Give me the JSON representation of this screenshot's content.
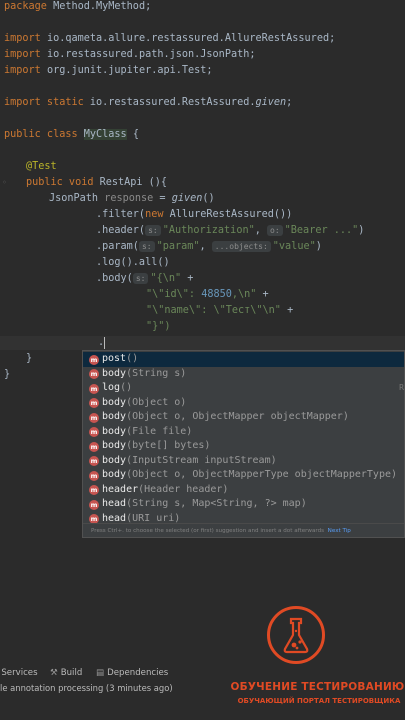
{
  "code": {
    "l1_kw": "package",
    "l1_rest": " Method.MyMethod;",
    "imp_kw": "import",
    "imp1": " io.qameta.allure.restassured.AllureRestAssured;",
    "imp2": " io.restassured.path.json.JsonPath;",
    "imp3": " org.junit.jupiter.api.Test;",
    "imp_static_kw": "import static",
    "imp4_pre": " io.restassured.RestAssured.",
    "imp4_it": "given",
    "imp4_end": ";",
    "class_kw": "public class",
    "class_name": "MyClass",
    "class_brace": " {",
    "annotation": "@Test",
    "method_kw": "public void",
    "method_rest": " RestApi (){",
    "decl_type": "JsonPath",
    "decl_var": " response",
    "decl_eq": " = ",
    "decl_given": "given",
    "decl_paren": "()",
    "filter_pre": ".filter(",
    "filter_new": "new",
    "filter_rest": " AllureRestAssured())",
    "header_pre": ".header(",
    "header_hint1": "s:",
    "header_s1": "\"Authorization\"",
    "header_comma": ", ",
    "header_hint2": "o:",
    "header_s2": "\"Bearer ...\"",
    "header_end": ")",
    "param_pre": ".param(",
    "param_hint1": "s:",
    "param_s1": "\"param\"",
    "param_comma": ", ",
    "param_hint2": "...objects:",
    "param_s2": "\"value\"",
    "param_end": ")",
    "log_line": ".log().all()",
    "body_pre": ".body(",
    "body_hint": "s:",
    "body_s1": "\"{\\n\"",
    "body_plus": " +",
    "body_l2_a": "\"\\\"id\\\": ",
    "body_l2_num": "48850",
    "body_l2_b": ",\\n\"",
    "body_l3": "\"\\\"name\\\": \\\"Тест\\\"\\n\"",
    "body_l4": "\"}\")",
    "dot": ".",
    "brace_close": "}",
    "brace_close2": "}"
  },
  "popup": {
    "items": [
      {
        "name": "post",
        "params": "()",
        "right": ""
      },
      {
        "name": "body",
        "params": "(String s)",
        "right": ""
      },
      {
        "name": "log",
        "params": "()",
        "right": "R"
      },
      {
        "name": "body",
        "params": "(Object o)",
        "right": ""
      },
      {
        "name": "body",
        "params": "(Object o, ObjectMapper objectMapper)",
        "right": ""
      },
      {
        "name": "body",
        "params": "(File file)",
        "right": ""
      },
      {
        "name": "body",
        "params": "(byte[] bytes)",
        "right": ""
      },
      {
        "name": "body",
        "params": "(InputStream inputStream)",
        "right": ""
      },
      {
        "name": "body",
        "params": "(Object o, ObjectMapperType objectMapperType)",
        "right": ""
      },
      {
        "name": "header",
        "params": "(Header header)",
        "right": ""
      },
      {
        "name": "head",
        "params": "(String s, Map<String, ?> map)",
        "right": ""
      },
      {
        "name": "head",
        "params": "(URI uri)",
        "right": ""
      }
    ],
    "method_icon_letter": "m",
    "footer_text": "Press Ctrl+. to choose the selected (or first) suggestion and insert a dot afterwards",
    "footer_link": "Next Tip"
  },
  "toolbar": {
    "services": "Services",
    "build": "Build",
    "dependencies": "Dependencies"
  },
  "status": "le annotation processing (3 minutes ago)",
  "brand": {
    "title": "ОБУЧЕНИЕ ТЕСТИРОВАНИЮ",
    "subtitle": "ОБУЧАЮЩИЙ ПОРТАЛ ТЕСТИРОВЩИКА"
  },
  "colors": {
    "editor_bg": "#2b2b2b",
    "keyword": "#cc7832",
    "string": "#6a8759",
    "annotation": "#bbb529",
    "number": "#6897bb",
    "brand": "#e04a24",
    "popup_bg": "#3c3f41",
    "popup_selected": "#0d293e",
    "method_icon": "#c75450"
  }
}
